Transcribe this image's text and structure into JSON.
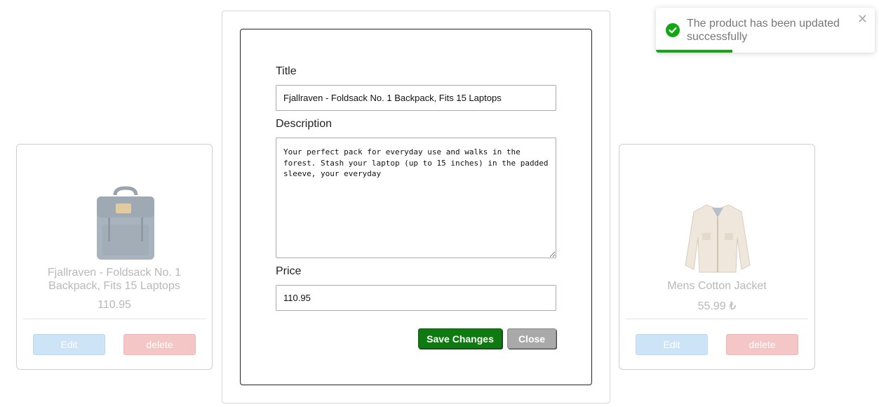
{
  "products": [
    {
      "title": "Fjallraven - Foldsack No. 1 Backpack, Fits 15 Laptops",
      "price": "110.95",
      "image": "backpack-image",
      "edit_label": "Edit",
      "delete_label": "delete"
    },
    {
      "title": "Mens Cotton Jacket",
      "price": "55.99 ₺",
      "image": "jacket-image",
      "edit_label": "Edit",
      "delete_label": "delete"
    }
  ],
  "modal": {
    "title_label": "Title",
    "title_value": "Fjallraven - Foldsack No. 1 Backpack, Fits 15 Laptops",
    "description_label": "Description",
    "description_value": "Your perfect pack for everyday use and walks in the forest. Stash your laptop (up to 15 inches) in the padded sleeve, your everyday",
    "price_label": "Price",
    "price_value": "110.95",
    "save_label": "Save Changes",
    "close_label": "Close"
  },
  "toast": {
    "message": "The product has been updated successfully",
    "icon": "check-circle-icon",
    "close_icon": "close-icon",
    "progress": 0.35,
    "color": "#13a813"
  },
  "colors": {
    "save": "#0f7a0f",
    "close": "#a9a9a9",
    "edit": "#cde4f6",
    "delete": "#f5c6c6"
  }
}
